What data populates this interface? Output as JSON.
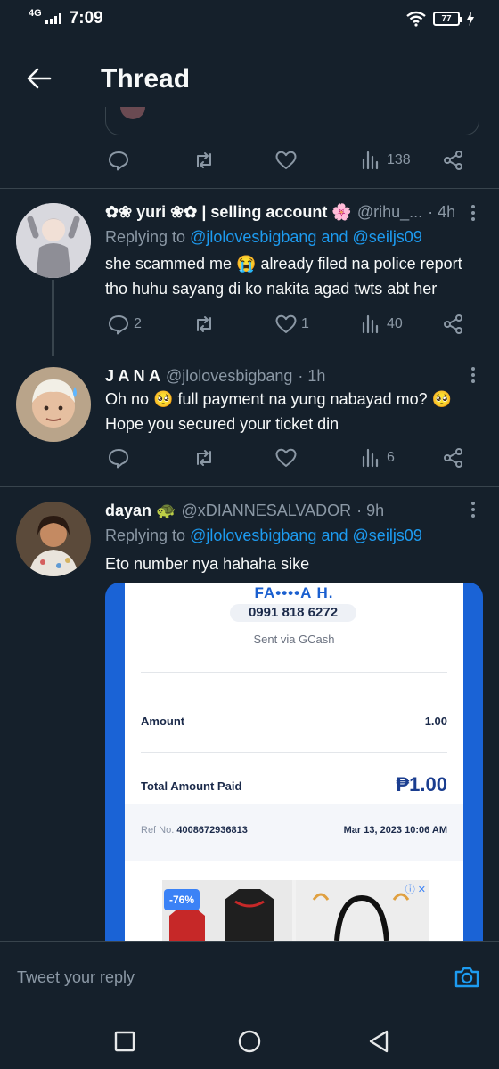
{
  "status_bar": {
    "network": "4G",
    "time": "7:09",
    "battery": "77"
  },
  "header": {
    "title": "Thread",
    "back_icon": "arrow-left-icon"
  },
  "top_tweet_actions": {
    "views": "138"
  },
  "tweets": [
    {
      "name": "✿❀ yuri ❀✿ | selling account 🌸",
      "handle": "@rihu_...",
      "time": "· 4h",
      "replying_prefix": "Replying to",
      "replying_to_1": "@jlolovesbigbang",
      "replying_and": "and",
      "replying_to_2": "@seiljs09",
      "text": "she scammed me 😭 already filed na police report tho huhu sayang di ko nakita agad twts abt her",
      "replies": "2",
      "retweets": "",
      "likes": "1",
      "views": "40"
    },
    {
      "name": "J A N A",
      "handle": "@jlolovesbigbang",
      "time": "· 1h",
      "text": "Oh no 🥺 full payment na yung nabayad mo? 🥺 Hope you secured your ticket din",
      "replies": "",
      "retweets": "",
      "likes": "",
      "views": "6"
    },
    {
      "name": "dayan 🐢",
      "handle": "@xDIANNESALVADOR",
      "time": "· 9h",
      "replying_prefix": "Replying to",
      "replying_to_1": "@jlolovesbigbang",
      "replying_and": "and",
      "replying_to_2": "@seiljs09",
      "text": "Eto number nya hahaha sike"
    }
  ],
  "receipt": {
    "recipient": "FA••••A H.",
    "phone": "0991 818 6272",
    "sent_via": "Sent via GCash",
    "amount_label": "Amount",
    "amount_value": "1.00",
    "total_label": "Total Amount Paid",
    "total_value": "₱1.00",
    "ref_label": "Ref No.",
    "ref_value": "4008672936813",
    "date": "Mar 13, 2023 10:06 AM",
    "ad_discount": "-76%",
    "ad_close": "ⓘ ✕"
  },
  "reply_bar": {
    "placeholder": "Tweet your reply"
  },
  "colors": {
    "background": "#15202b",
    "accent": "#1d9bf0",
    "muted": "#8b98a5",
    "divider": "#38444d"
  }
}
